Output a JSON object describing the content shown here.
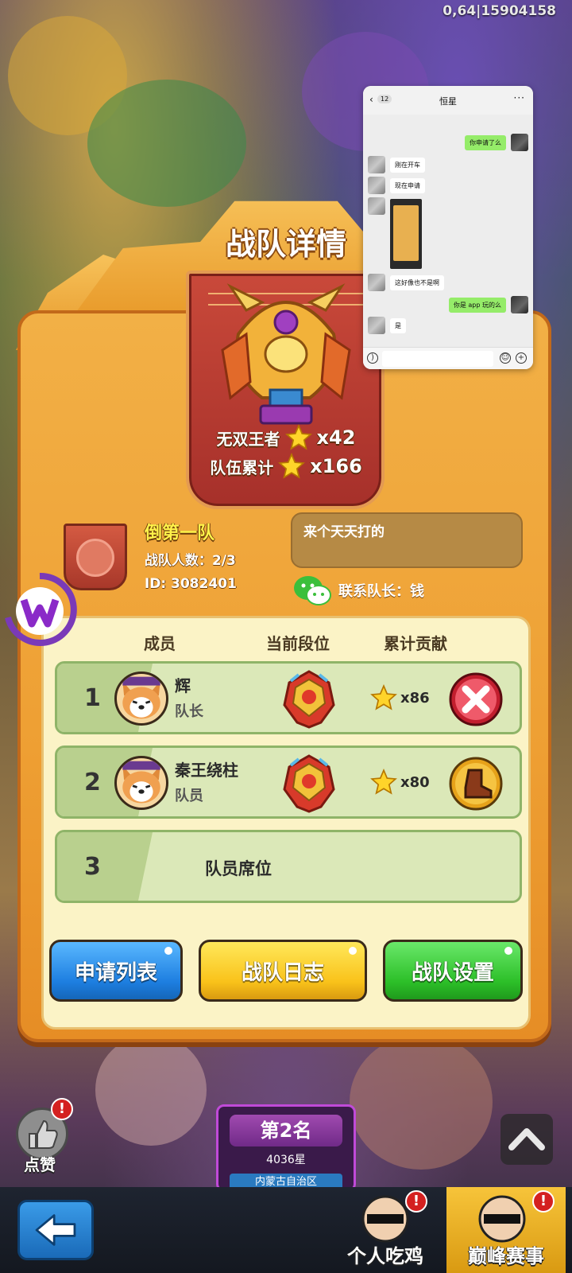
{
  "status": {
    "code": "0,64|15904158"
  },
  "panel": {
    "title": "战队详情",
    "stats": {
      "king_label": "无双王者",
      "king_value": "x42",
      "total_label": "队伍累计",
      "total_value": "x166"
    },
    "team": {
      "name": "倒第一队",
      "member_count": "战队人数：2/3",
      "id": "ID: 3082401",
      "motto": "来个天天打的",
      "contact": "联系队长：钱"
    },
    "members_header": {
      "member": "成员",
      "rank": "当前段位",
      "contribution": "累计贡献"
    },
    "members": [
      {
        "index": "1",
        "name": "辉",
        "role": "队长",
        "contribution": "x86",
        "action": "remove"
      },
      {
        "index": "2",
        "name": "秦王绕柱",
        "role": "队员",
        "contribution": "x80",
        "action": "boot"
      }
    ],
    "empty_slot": {
      "index": "3",
      "label": "队员席位"
    },
    "buttons": {
      "apply_list": "申请列表",
      "team_log": "战队日志",
      "team_settings": "战队设置"
    }
  },
  "bottom": {
    "like_label": "点赞",
    "notif_mark": "!",
    "rank_title": "第2名",
    "rank_stars": "4036星",
    "rank_region": "内蒙古自治区",
    "tabs": [
      {
        "label": "个人吃鸡"
      },
      {
        "label": "巅峰赛事"
      }
    ]
  },
  "chat": {
    "title": "恒星",
    "unread": "12",
    "more": "···",
    "messages": [
      {
        "side": "right",
        "text": "你申请了么"
      },
      {
        "side": "left",
        "text": "刚在开车"
      },
      {
        "side": "left",
        "text": "现在申请"
      },
      {
        "side": "left",
        "text": "这好像也不是啊"
      },
      {
        "side": "right",
        "text": "你是 app 玩的么"
      },
      {
        "side": "left",
        "text": "是"
      }
    ]
  },
  "colors": {
    "panel": "#ee9f33",
    "members_bg": "#fbf3c6",
    "row_bg": "#dbe8b8",
    "btn_blue": "#1d7ee0",
    "btn_yellow": "#f9c21a",
    "btn_green": "#2cbf28",
    "team_name": "#fff24a"
  },
  "icons": [
    "star-icon",
    "trophy-icon",
    "wechat-icon",
    "close-icon",
    "boot-icon",
    "back-arrow-icon",
    "up-arrow-icon",
    "thumbs-up-icon"
  ]
}
